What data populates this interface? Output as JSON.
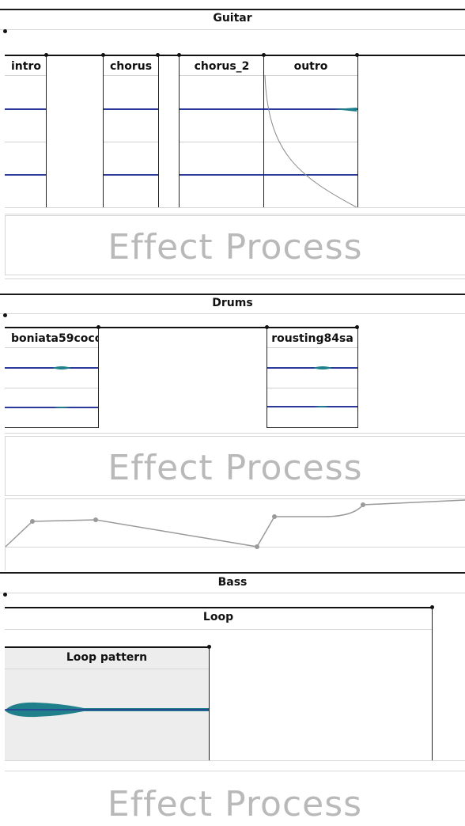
{
  "tracks": {
    "guitar": {
      "title": "Guitar",
      "clips": [
        {
          "label": "intro"
        },
        {
          "label": "chorus"
        },
        {
          "label": "chorus_2"
        },
        {
          "label": "outro"
        }
      ],
      "effect_label": "Effect Process"
    },
    "drums": {
      "title": "Drums",
      "clips": [
        {
          "label": "boniata59coco"
        },
        {
          "label": "rousting84sa"
        }
      ],
      "effect_label": "Effect Process"
    },
    "bass": {
      "title": "Bass",
      "loop": {
        "title": "Loop",
        "pattern_label": "Loop pattern"
      },
      "effect_label": "Effect Process"
    }
  },
  "colors": {
    "waveform": "#2b3a9a",
    "waveform_fill": "#1f7f8a",
    "effect_text": "#b9b9b9",
    "automation": "#9a9a9a",
    "loop_bg": "#ededed"
  }
}
